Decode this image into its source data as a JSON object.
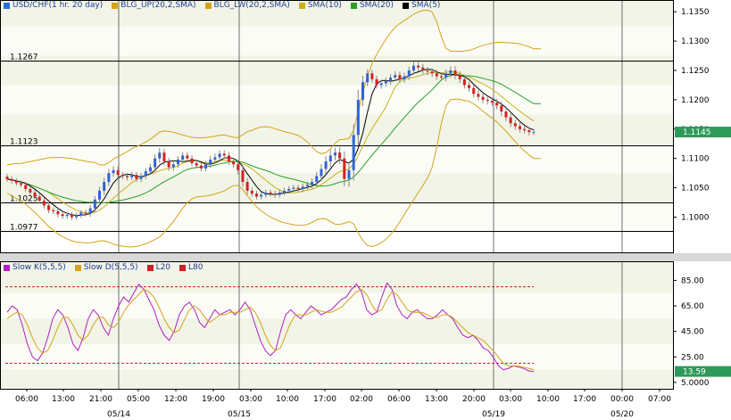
{
  "chart_data": [
    {
      "type": "candlestick",
      "legend": [
        {
          "label": "USD/CHF(1 hr.  20 day)",
          "color": "#2a6dd9"
        },
        {
          "label": "BLG_UP(20,2,SMA)",
          "color": "#d6a21a"
        },
        {
          "label": "BLG_LW(20,2,SMA)",
          "color": "#d6a21a"
        },
        {
          "label": "SMA(10)",
          "color": "#c9b21a"
        },
        {
          "label": "SMA(20)",
          "color": "#2aa02a"
        },
        {
          "label": "SMA(5)",
          "color": "#000000"
        }
      ],
      "ylim": [
        1.094,
        1.137
      ],
      "yticks": [
        "1.1350",
        "1.1300",
        "1.1250",
        "1.1200",
        "1.1150",
        "1.1100",
        "1.1050",
        "1.1000"
      ],
      "ytick_values": [
        1.135,
        1.13,
        1.125,
        1.12,
        1.115,
        1.11,
        1.105,
        1.1
      ],
      "levels": [
        {
          "label": "1.1267",
          "value": 1.1267
        },
        {
          "label": "1.1123",
          "value": 1.1123
        },
        {
          "label": "1.1025",
          "value": 1.1025
        },
        {
          "label": "1.0977",
          "value": 1.0977
        }
      ],
      "last_price": "1.1145",
      "last_value": 1.1145,
      "x_tick_labels": [
        "06:00",
        "13:00",
        "21:00",
        "05:00",
        "12:00",
        "19:00",
        "03:00",
        "10:00",
        "17:00",
        "02:00",
        "06:00",
        "13:00",
        "20:00",
        "03:00",
        "10:00",
        "17:00",
        "00:00",
        "07:00"
      ],
      "date_labels": [
        "05/14",
        "05/15",
        "05/19",
        "05/20"
      ],
      "close": [
        1.1065,
        1.1062,
        1.1058,
        1.1055,
        1.1048,
        1.1042,
        1.1035,
        1.1028,
        1.102,
        1.1012,
        1.101,
        1.1005,
        1.1002,
        1.1004,
        1.1,
        1.1003,
        1.1008,
        1.1006,
        1.1015,
        1.103,
        1.1045,
        1.106,
        1.1075,
        1.108,
        1.1072,
        1.107,
        1.1068,
        1.1072,
        1.1065,
        1.107,
        1.1078,
        1.1085,
        1.11,
        1.111,
        1.1095,
        1.1085,
        1.109,
        1.1098,
        1.1105,
        1.11,
        1.1092,
        1.1088,
        1.1083,
        1.109,
        1.1098,
        1.1102,
        1.1108,
        1.1105,
        1.1095,
        1.109,
        1.108,
        1.106,
        1.1045,
        1.104,
        1.1035,
        1.1038,
        1.1042,
        1.104,
        1.1038,
        1.1042,
        1.1045,
        1.1048,
        1.105,
        1.1048,
        1.1052,
        1.1055,
        1.106,
        1.107,
        1.1082,
        1.1095,
        1.1105,
        1.111,
        1.11,
        1.1065,
        1.108,
        1.114,
        1.12,
        1.123,
        1.1245,
        1.1235,
        1.1225,
        1.1228,
        1.1232,
        1.1238,
        1.1242,
        1.1235,
        1.124,
        1.125,
        1.1258,
        1.1255,
        1.125,
        1.1248,
        1.1245,
        1.124,
        1.1238,
        1.1245,
        1.125,
        1.1242,
        1.1235,
        1.1225,
        1.122,
        1.121,
        1.1205,
        1.12,
        1.1198,
        1.1195,
        1.119,
        1.118,
        1.117,
        1.116,
        1.1155,
        1.115,
        1.1148,
        1.1145,
        1.1145
      ],
      "volatility": [
        0.0008,
        0.0008,
        0.0007,
        0.0007,
        0.0008,
        0.0008,
        0.0007,
        0.0008,
        0.0009,
        0.0009,
        0.0008,
        0.0009,
        0.0008,
        0.0008,
        0.0008,
        0.0008,
        0.0007,
        0.0008,
        0.0009,
        0.001,
        0.0011,
        0.0012,
        0.0012,
        0.0011,
        0.001,
        0.0009,
        0.0009,
        0.0009,
        0.0008,
        0.0009,
        0.0009,
        0.001,
        0.0012,
        0.0013,
        0.0011,
        0.001,
        0.001,
        0.001,
        0.001,
        0.001,
        0.0009,
        0.0009,
        0.0009,
        0.0009,
        0.001,
        0.001,
        0.001,
        0.001,
        0.001,
        0.001,
        0.0012,
        0.0014,
        0.0011,
        0.0009,
        0.0008,
        0.0008,
        0.0008,
        0.0008,
        0.0008,
        0.0008,
        0.0008,
        0.0008,
        0.0008,
        0.0008,
        0.0009,
        0.0009,
        0.001,
        0.0012,
        0.0014,
        0.0015,
        0.0016,
        0.0014,
        0.0016,
        0.002,
        0.0022,
        0.003,
        0.0028,
        0.0018,
        0.0012,
        0.001,
        0.001,
        0.001,
        0.001,
        0.001,
        0.0011,
        0.001,
        0.001,
        0.0011,
        0.0012,
        0.0011,
        0.001,
        0.001,
        0.001,
        0.001,
        0.001,
        0.0011,
        0.0012,
        0.0012,
        0.0011,
        0.001,
        0.001,
        0.001,
        0.001,
        0.001,
        0.001,
        0.001,
        0.0011,
        0.0012,
        0.0011,
        0.0011,
        0.001,
        0.001,
        0.0009,
        0.0009,
        0.0008
      ]
    },
    {
      "type": "line",
      "legend": [
        {
          "label": "Slow K(5,5,5)",
          "color": "#b020c0"
        },
        {
          "label": "Slow D(5,5,5)",
          "color": "#d6a21a"
        },
        {
          "label": "L20",
          "color": "#cc2020"
        },
        {
          "label": "L80",
          "color": "#cc2020"
        }
      ],
      "ylim": [
        0,
        100
      ],
      "yticks": [
        "85.00",
        "65.00",
        "45.00",
        "25.00",
        "5.0000"
      ],
      "ytick_values": [
        85,
        65,
        45,
        25,
        5
      ],
      "levels": [
        80,
        20
      ],
      "last_price": "13.59",
      "last_value": 13.59,
      "series": [
        {
          "values": [
            60,
            65,
            62,
            50,
            35,
            25,
            22,
            28,
            40,
            55,
            62,
            58,
            48,
            35,
            30,
            40,
            55,
            62,
            58,
            48,
            42,
            55,
            65,
            72,
            68,
            75,
            82,
            78,
            70,
            62,
            50,
            42,
            38,
            45,
            58,
            65,
            68,
            62,
            52,
            48,
            55,
            62,
            58,
            60,
            62,
            58,
            62,
            68,
            62,
            50,
            38,
            30,
            26,
            30,
            45,
            58,
            62,
            58,
            55,
            60,
            65,
            62,
            58,
            60,
            62,
            66,
            70,
            72,
            78,
            82,
            76,
            62,
            58,
            60,
            72,
            83,
            78,
            65,
            58,
            55,
            60,
            62,
            58,
            55,
            55,
            58,
            62,
            58,
            55,
            48,
            42,
            40,
            42,
            38,
            32,
            30,
            25,
            18,
            15,
            16,
            18,
            17,
            16,
            14,
            13.59
          ]
        },
        {
          "values": [
            55,
            58,
            60,
            58,
            50,
            40,
            32,
            28,
            30,
            38,
            48,
            56,
            56,
            50,
            42,
            38,
            42,
            50,
            56,
            56,
            50,
            48,
            52,
            60,
            66,
            70,
            74,
            78,
            76,
            72,
            64,
            55,
            48,
            44,
            46,
            54,
            62,
            65,
            62,
            56,
            52,
            55,
            58,
            58,
            60,
            60,
            60,
            62,
            64,
            60,
            52,
            42,
            34,
            30,
            32,
            42,
            52,
            58,
            58,
            58,
            60,
            62,
            61,
            60,
            60,
            62,
            64,
            68,
            72,
            76,
            78,
            74,
            66,
            60,
            62,
            70,
            76,
            74,
            68,
            62,
            60,
            60,
            60,
            58,
            56,
            56,
            58,
            58,
            56,
            52,
            48,
            44,
            42,
            40,
            38,
            34,
            30,
            25,
            20,
            18,
            18,
            18,
            17,
            16,
            15
          ]
        }
      ],
      "x_tick_labels": [
        "06:00",
        "13:00",
        "21:00",
        "05:00",
        "12:00",
        "19:00",
        "03:00",
        "10:00",
        "17:00",
        "02:00",
        "06:00",
        "13:00",
        "20:00",
        "03:00",
        "10:00",
        "17:00",
        "00:00",
        "07:00"
      ],
      "date_labels": [
        "05/14",
        "05/15",
        "05/19",
        "05/20"
      ]
    }
  ]
}
